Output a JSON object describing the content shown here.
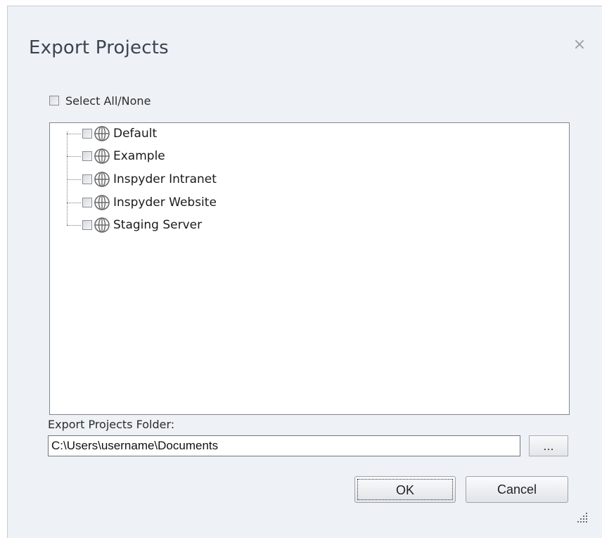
{
  "dialog": {
    "title": "Export Projects",
    "close_glyph": "×"
  },
  "select_all": {
    "label": "Select All/None",
    "checked": false
  },
  "projects": [
    {
      "label": "Default",
      "checked": false,
      "icon": "globe-icon"
    },
    {
      "label": "Example",
      "checked": false,
      "icon": "globe-icon"
    },
    {
      "label": "Inspyder Intranet",
      "checked": false,
      "icon": "globe-icon"
    },
    {
      "label": "Inspyder Website",
      "checked": false,
      "icon": "globe-icon"
    },
    {
      "label": "Staging Server",
      "checked": false,
      "icon": "globe-icon"
    }
  ],
  "folder": {
    "label": "Export Projects Folder:",
    "value": "C:\\Users\\username\\Documents",
    "browse_label": "..."
  },
  "buttons": {
    "ok_label": "OK",
    "cancel_label": "Cancel"
  },
  "colors": {
    "dialog_bg": "#eef2f6",
    "title_text": "#3b4452"
  }
}
